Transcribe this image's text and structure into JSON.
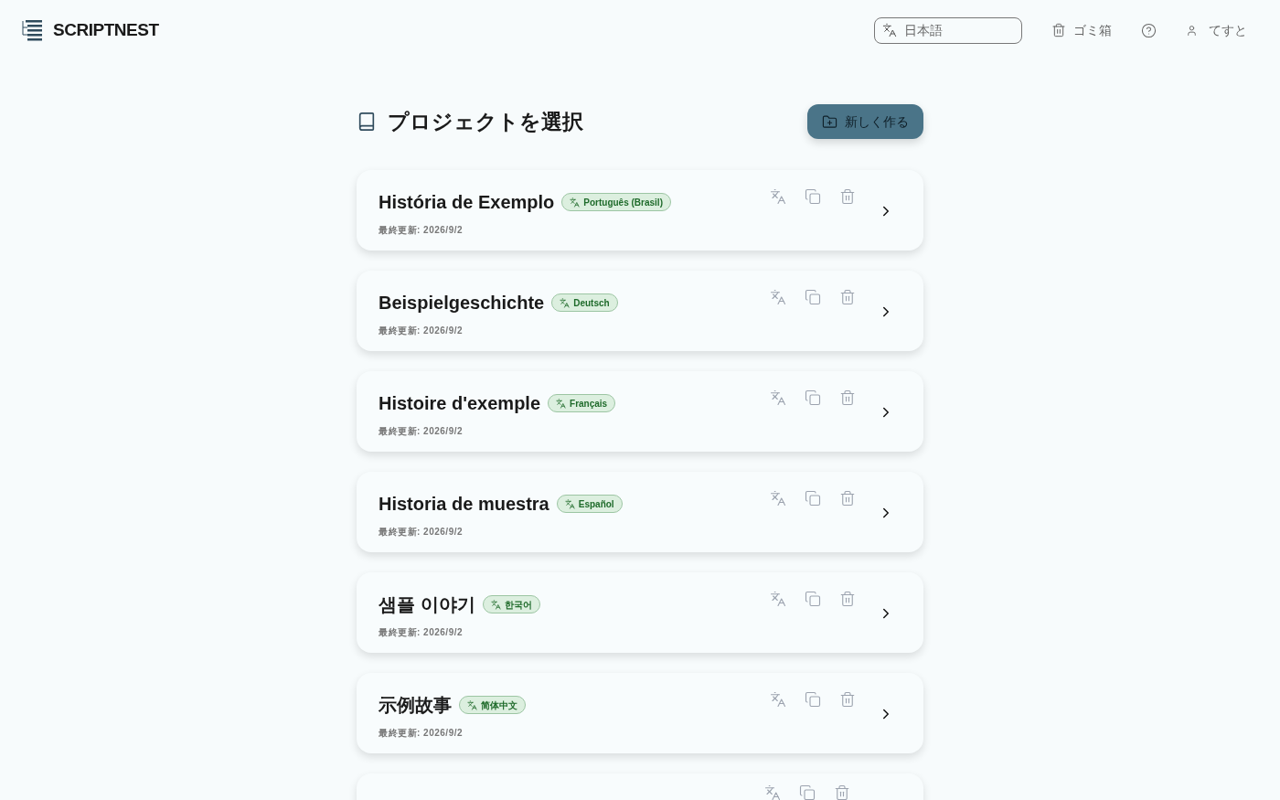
{
  "header": {
    "brand": "SCRIPTNEST",
    "language_field": {
      "value": "日本語"
    },
    "trash_label": "ゴミ箱",
    "user_label": "てすと"
  },
  "page": {
    "title": "プロジェクトを選択",
    "new_button": "新しく作る"
  },
  "projects": [
    {
      "title": "História de Exemplo",
      "language": "Português (Brasil)",
      "updated": "最終更新: 2026/9/2"
    },
    {
      "title": "Beispielgeschichte",
      "language": "Deutsch",
      "updated": "最終更新: 2026/9/2"
    },
    {
      "title": "Histoire d'exemple",
      "language": "Français",
      "updated": "最終更新: 2026/9/2"
    },
    {
      "title": "Historia de muestra",
      "language": "Español",
      "updated": "最終更新: 2026/9/2"
    },
    {
      "title": "샘플 이야기",
      "language": "한국어",
      "updated": "最終更新: 2026/9/2"
    },
    {
      "title": "示例故事",
      "language": "简体中文",
      "updated": "最終更新: 2026/9/2"
    }
  ]
}
